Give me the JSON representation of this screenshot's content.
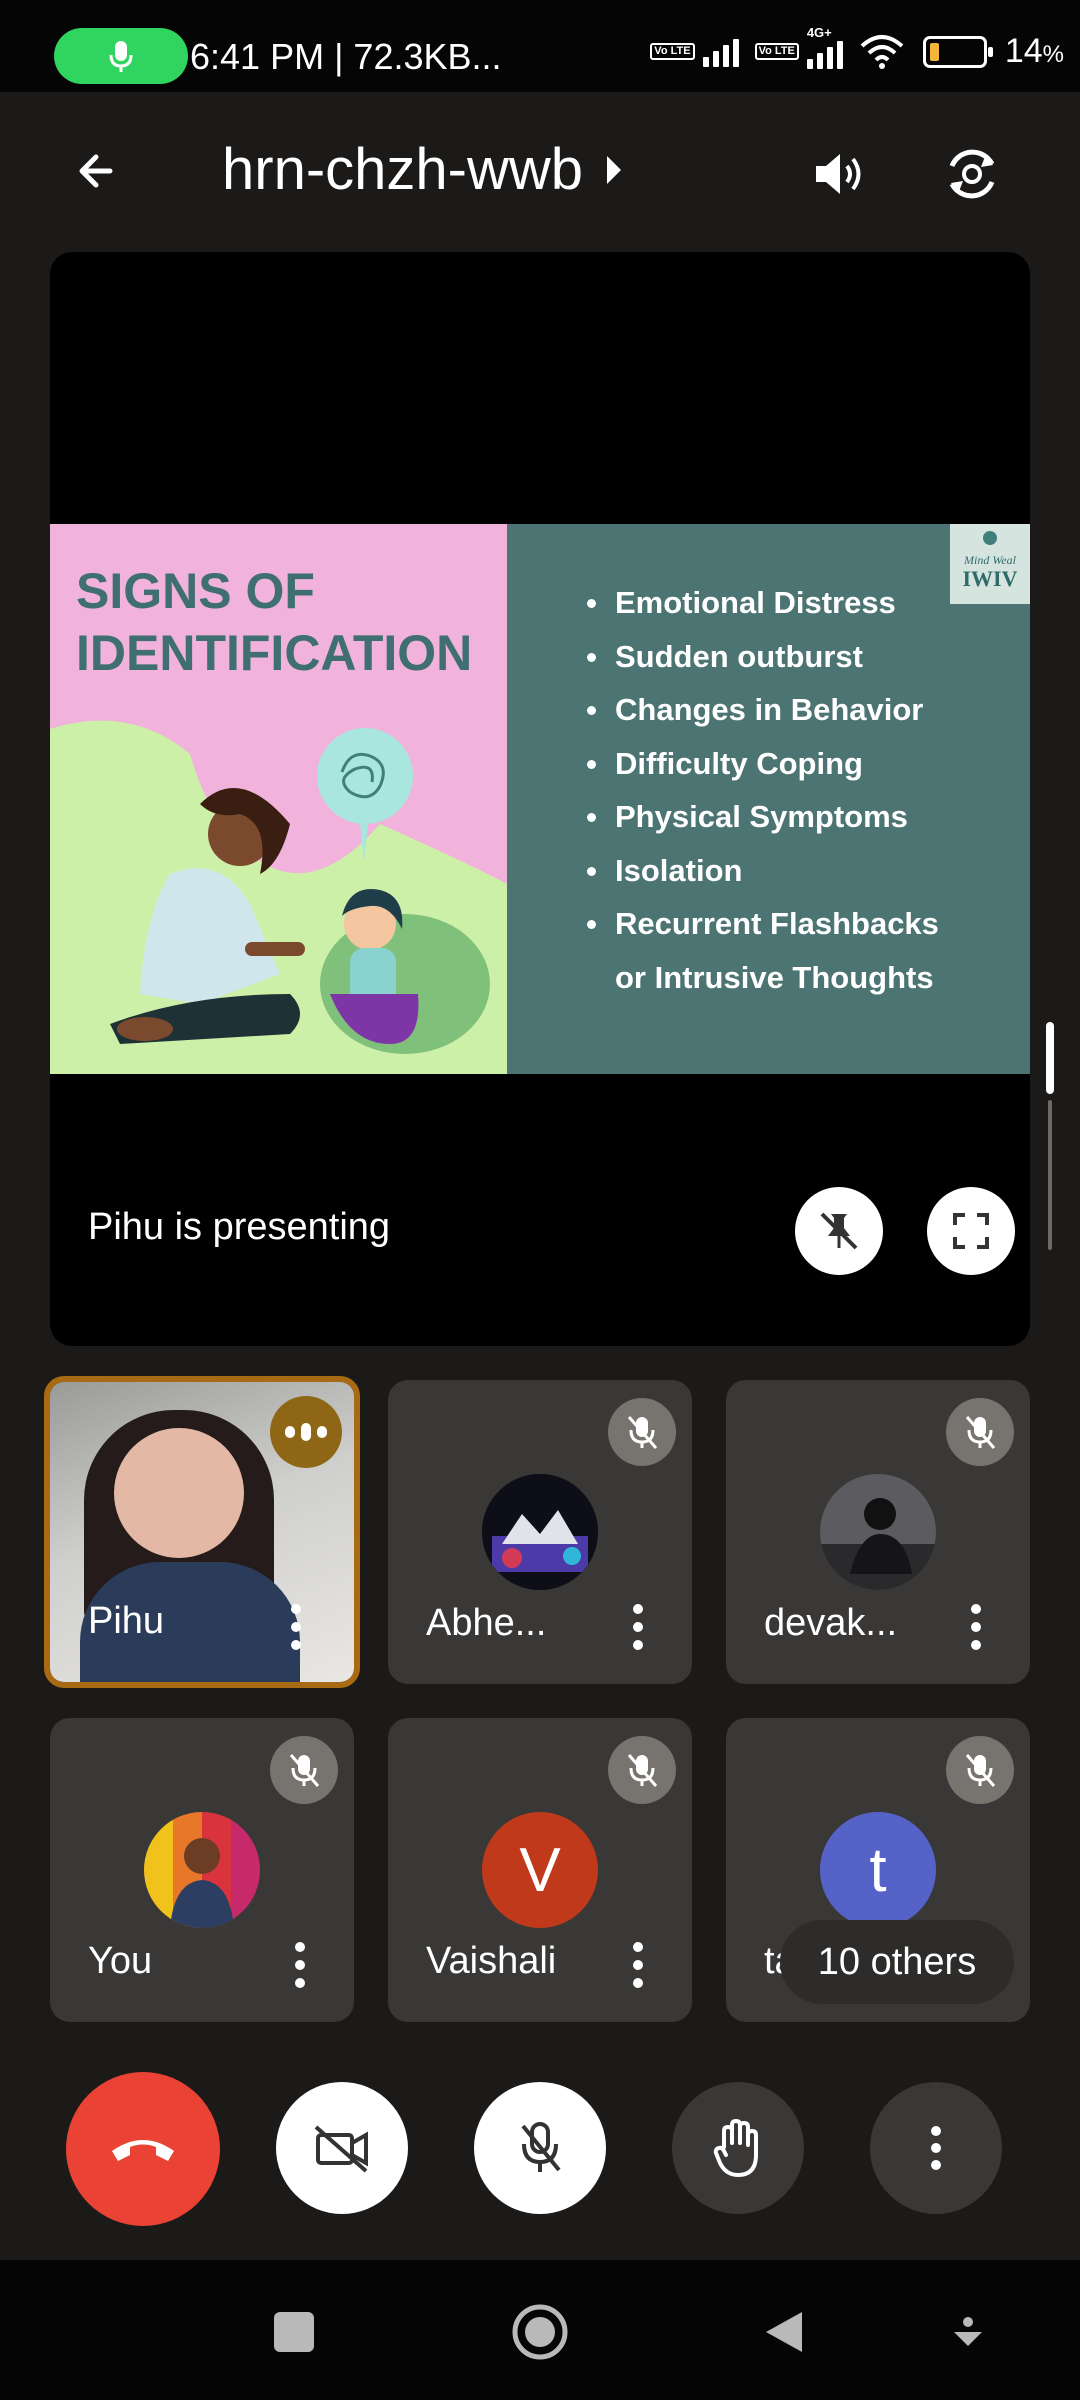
{
  "status_bar": {
    "time_and_speed": "6:41 PM | 72.3KB...",
    "network_badge_1": "Vo LTE",
    "network_badge_2": "Vo LTE",
    "network_label": "4G+",
    "battery_percent": "14",
    "battery_unit": "%",
    "battery_level": 0.14,
    "accent_green": "#2fd55e"
  },
  "header": {
    "meeting_code": "hrn-chzh-wwb"
  },
  "presentation": {
    "slide": {
      "title_line1": "SIGNS OF",
      "title_line2": "IDENTIFICATION",
      "bullets": [
        "Emotional Distress",
        "Sudden outburst",
        "Changes in Behavior",
        "Difficulty Coping",
        "Physical Symptoms",
        "Isolation",
        "Recurrent Flashbacks"
      ],
      "bullet_continuation": "or Intrusive Thoughts",
      "logo_text": "Mind Weal"
    },
    "presenter_label": "Pihu is presenting"
  },
  "participants": [
    {
      "name": "Pihu",
      "state": "speaking"
    },
    {
      "name": "Abhe...",
      "state": "muted"
    },
    {
      "name": "devak...",
      "state": "muted"
    },
    {
      "name": "You",
      "state": "muted"
    },
    {
      "name": "Vaishali",
      "state": "muted",
      "initial": "V",
      "color": "#c0391b"
    },
    {
      "name": "tanya",
      "state": "muted",
      "initial": "t",
      "color": "#5563c9"
    }
  ],
  "others_label": "10 others",
  "controls": {
    "end_call_color": "#ea4335"
  }
}
